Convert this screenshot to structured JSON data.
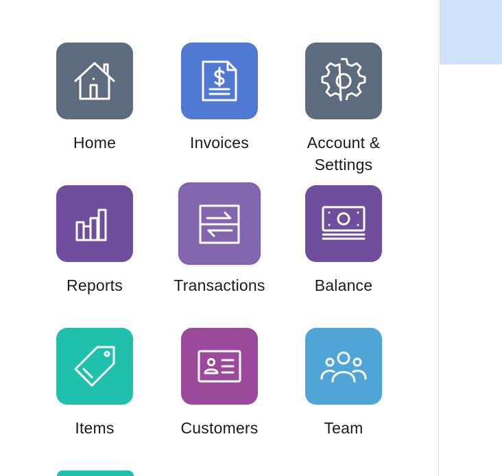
{
  "apps": [
    {
      "name": "home",
      "label": "Home",
      "icon": "home-icon",
      "color": "#5d6b7f"
    },
    {
      "name": "invoices",
      "label": "Invoices",
      "icon": "invoice-icon",
      "color": "#5079d3"
    },
    {
      "name": "account-settings",
      "label": "Account &\nSettings",
      "icon": "gear-icon",
      "color": "#5d6b7f"
    },
    {
      "name": "reports",
      "label": "Reports",
      "icon": "bar-chart-icon",
      "color": "#6f4e9e"
    },
    {
      "name": "transactions",
      "label": "Transactions",
      "icon": "transfer-arrows-icon",
      "color": "#8266ae"
    },
    {
      "name": "balance",
      "label": "Balance",
      "icon": "cash-stack-icon",
      "color": "#6f4e9e"
    },
    {
      "name": "items",
      "label": "Items",
      "icon": "tag-icon",
      "color": "#1fc1ad"
    },
    {
      "name": "customers",
      "label": "Customers",
      "icon": "id-card-icon",
      "color": "#9b4a9b"
    },
    {
      "name": "team",
      "label": "Team",
      "icon": "team-icon",
      "color": "#4fa6d6"
    }
  ]
}
